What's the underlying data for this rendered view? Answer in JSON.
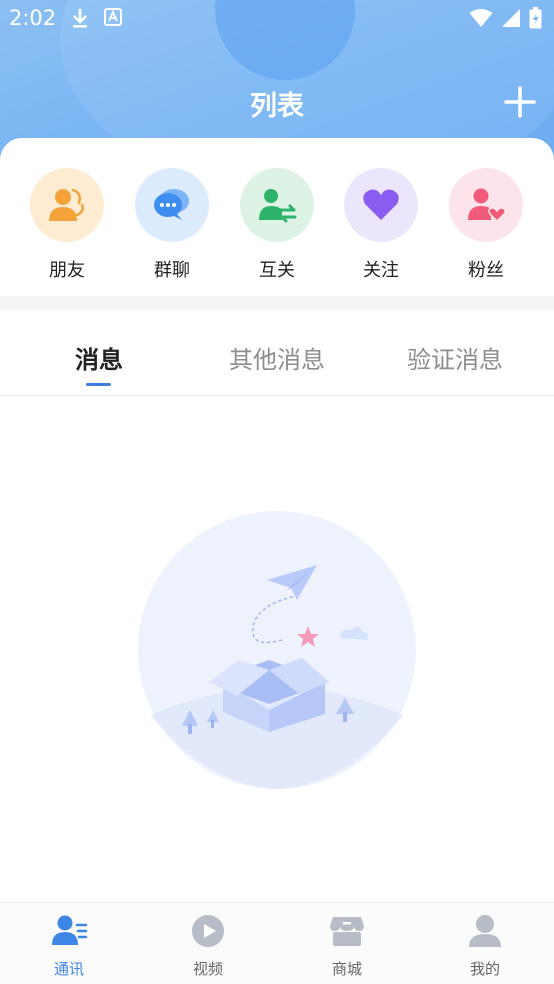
{
  "status_bar": {
    "time": "2:02"
  },
  "header": {
    "title": "列表",
    "add_icon": "plus-icon"
  },
  "quick_actions": [
    {
      "label": "朋友",
      "icon": "friends-icon",
      "bg": "#fdebd2",
      "color": "#f3a33a"
    },
    {
      "label": "群聊",
      "icon": "group-chat-icon",
      "bg": "#dcebfd",
      "color": "#3d8ef0"
    },
    {
      "label": "互关",
      "icon": "mutual-follow-icon",
      "bg": "#ddf3e6",
      "color": "#2db36a"
    },
    {
      "label": "关注",
      "icon": "heart-icon",
      "bg": "#ebe6fc",
      "color": "#8a5cf2"
    },
    {
      "label": "粉丝",
      "icon": "fans-icon",
      "bg": "#fde4ea",
      "color": "#f15b7a"
    }
  ],
  "tabs": [
    {
      "label": "消息",
      "active": true
    },
    {
      "label": "其他消息",
      "active": false
    },
    {
      "label": "验证消息",
      "active": false
    }
  ],
  "bottom_nav": [
    {
      "label": "通讯",
      "icon": "contacts-icon",
      "active": true
    },
    {
      "label": "视频",
      "icon": "video-play-icon",
      "active": false
    },
    {
      "label": "商城",
      "icon": "store-icon",
      "active": false
    },
    {
      "label": "我的",
      "icon": "profile-icon",
      "active": false
    }
  ],
  "colors": {
    "accent": "#3d86e6",
    "header_bg": "#7ab6f3"
  }
}
